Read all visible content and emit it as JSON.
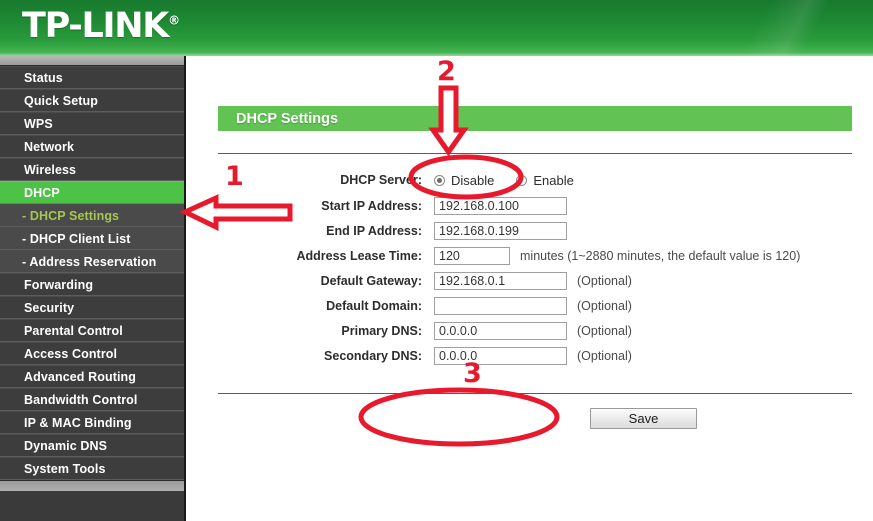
{
  "brand": {
    "name": "TP-LINK",
    "registered_mark": "®"
  },
  "sidebar": {
    "items": [
      {
        "label": "Status",
        "type": "top",
        "state": "normal"
      },
      {
        "label": "Quick Setup",
        "type": "top",
        "state": "normal"
      },
      {
        "label": "WPS",
        "type": "top",
        "state": "normal"
      },
      {
        "label": "Network",
        "type": "top",
        "state": "normal"
      },
      {
        "label": "Wireless",
        "type": "top",
        "state": "normal"
      },
      {
        "label": "DHCP",
        "type": "top",
        "state": "active"
      },
      {
        "label": "- DHCP Settings",
        "type": "sub",
        "state": "current"
      },
      {
        "label": "- DHCP Client List",
        "type": "sub",
        "state": "normal"
      },
      {
        "label": "- Address Reservation",
        "type": "sub",
        "state": "normal"
      },
      {
        "label": "Forwarding",
        "type": "top",
        "state": "normal"
      },
      {
        "label": "Security",
        "type": "top",
        "state": "normal"
      },
      {
        "label": "Parental Control",
        "type": "top",
        "state": "normal"
      },
      {
        "label": "Access Control",
        "type": "top",
        "state": "normal"
      },
      {
        "label": "Advanced Routing",
        "type": "top",
        "state": "normal"
      },
      {
        "label": "Bandwidth Control",
        "type": "top",
        "state": "normal"
      },
      {
        "label": "IP & MAC Binding",
        "type": "top",
        "state": "normal"
      },
      {
        "label": "Dynamic DNS",
        "type": "top",
        "state": "normal"
      },
      {
        "label": "System Tools",
        "type": "top",
        "state": "normal"
      }
    ]
  },
  "main": {
    "title": "DHCP Settings",
    "fields": {
      "dhcp_server": {
        "label": "DHCP Server:",
        "options": [
          {
            "label": "Disable",
            "selected": true
          },
          {
            "label": "Enable",
            "selected": false
          }
        ]
      },
      "start_ip": {
        "label": "Start IP Address:",
        "value": "192.168.0.100"
      },
      "end_ip": {
        "label": "End IP Address:",
        "value": "192.168.0.199"
      },
      "lease_time": {
        "label": "Address Lease Time:",
        "value": "120",
        "hint": "minutes (1~2880 minutes, the default value is 120)"
      },
      "default_gateway": {
        "label": "Default Gateway:",
        "value": "192.168.0.1",
        "note": "(Optional)"
      },
      "default_domain": {
        "label": "Default Domain:",
        "value": "",
        "note": "(Optional)"
      },
      "primary_dns": {
        "label": "Primary DNS:",
        "value": "0.0.0.0",
        "note": "(Optional)"
      },
      "secondary_dns": {
        "label": "Secondary DNS:",
        "value": "0.0.0.0",
        "note": "(Optional)"
      }
    },
    "save_label": "Save"
  },
  "annotations": {
    "step1": "1",
    "step2": "2",
    "step3": "3",
    "color": "#e8192c"
  }
}
